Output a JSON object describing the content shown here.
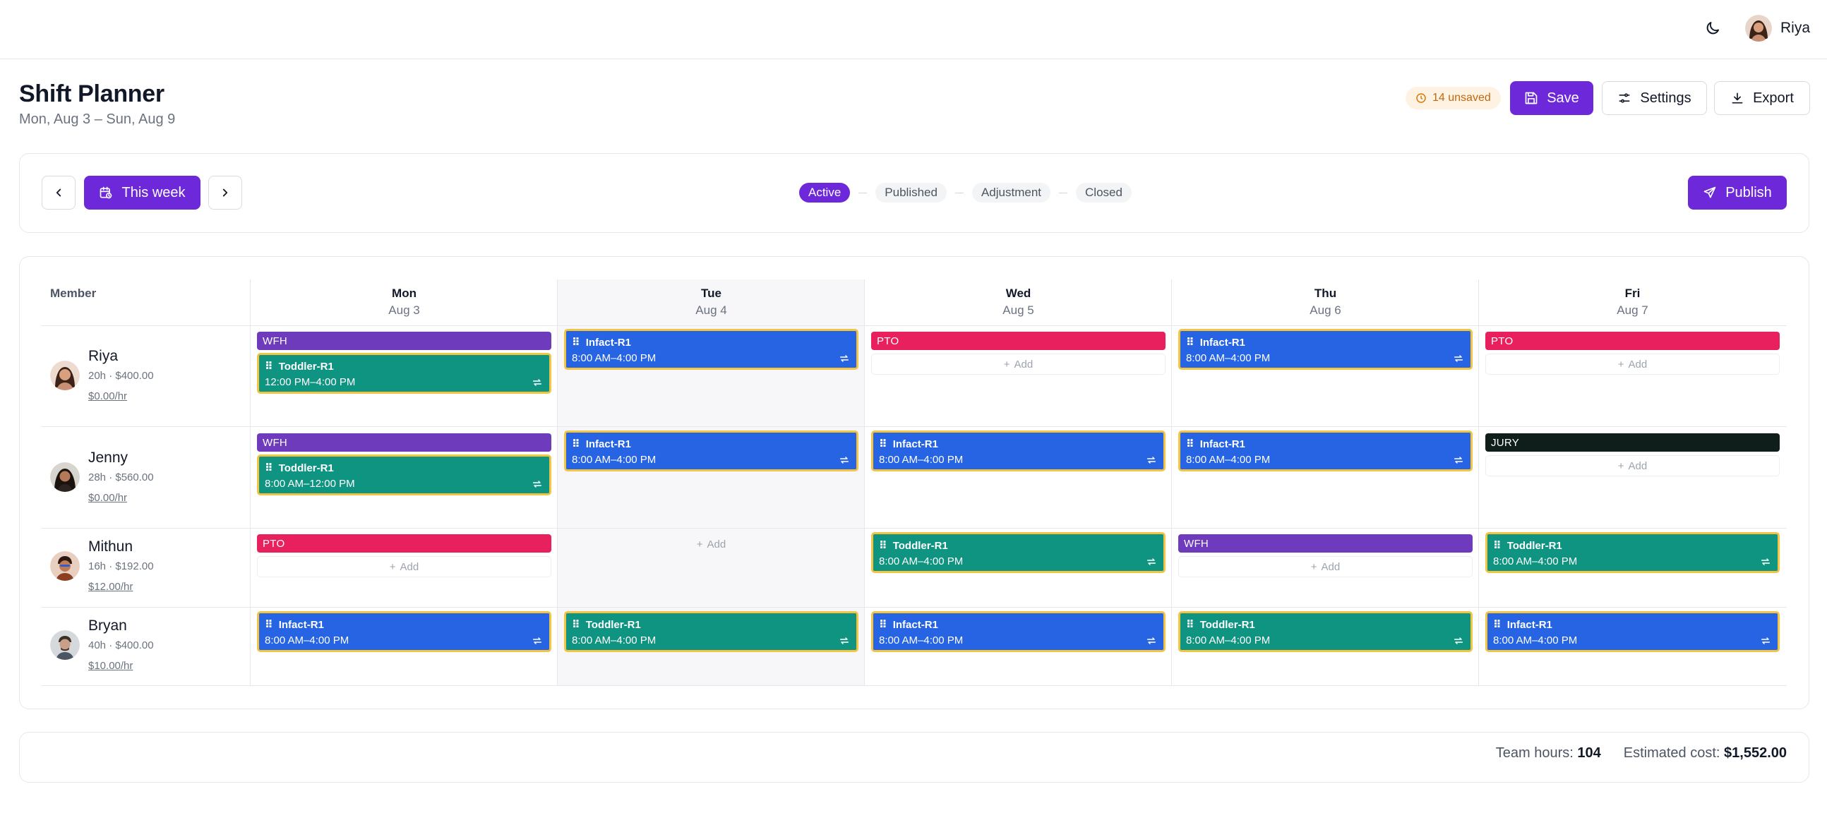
{
  "user": {
    "name": "Riya"
  },
  "page": {
    "title": "Shift Planner",
    "subtitle": "Mon, Aug 3 – Sun, Aug 9"
  },
  "actions": {
    "unsaved": "14 unsaved",
    "save": "Save",
    "settings": "Settings",
    "export": "Export",
    "publish": "Publish"
  },
  "week_nav": {
    "this_week": "This week"
  },
  "stages": [
    "Active",
    "Published",
    "Adjustment",
    "Closed"
  ],
  "grid": {
    "member_header": "Member",
    "days": [
      {
        "name": "Mon",
        "date": "Aug 3"
      },
      {
        "name": "Tue",
        "date": "Aug 4"
      },
      {
        "name": "Wed",
        "date": "Aug 5"
      },
      {
        "name": "Thu",
        "date": "Aug 6"
      },
      {
        "name": "Fri",
        "date": "Aug 7"
      }
    ],
    "add_label": "Add",
    "members": [
      {
        "name": "Riya",
        "stats": "20h · $400.00",
        "rate": "$0.00/hr"
      },
      {
        "name": "Jenny",
        "stats": "28h · $560.00",
        "rate": "$0.00/hr"
      },
      {
        "name": "Mithun",
        "stats": "16h · $192.00",
        "rate": "$12.00/hr"
      },
      {
        "name": "Bryan",
        "stats": "40h · $400.00",
        "rate": "$10.00/hr"
      }
    ],
    "tags": {
      "wfh": "WFH",
      "pto": "PTO",
      "jury": "JURY"
    },
    "shifts": {
      "infact": "Infact-R1",
      "toddler": "Toddler-R1",
      "t_12_4": "12:00 PM–4:00 PM",
      "t_8_12": "8:00 AM–12:00 PM",
      "t_8_4": "8:00 AM–4:00 PM"
    }
  },
  "totals": {
    "hours_label": "Team hours:",
    "hours": "104",
    "cost_label": "Estimated cost:",
    "cost": "$1,552.00"
  },
  "colors": {
    "accent": "#6d28d9",
    "infact": "#2664e3",
    "toddler": "#0f9482",
    "wfh": "#6e3bbd",
    "pto": "#e8215e",
    "jury": "#0f1e1b",
    "unsaved_border": "#f5c542"
  }
}
